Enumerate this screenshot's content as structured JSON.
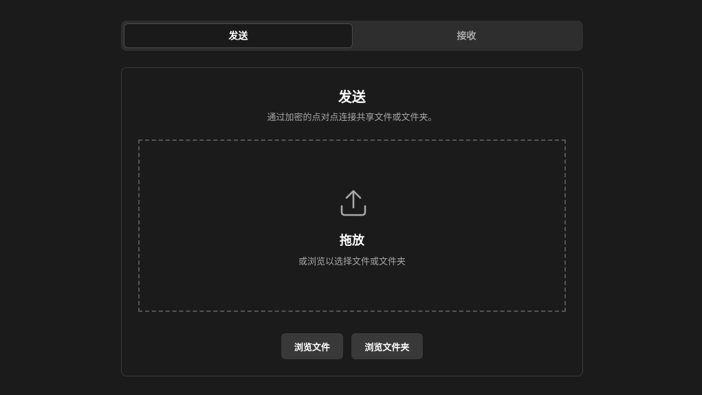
{
  "tabs": [
    {
      "label": "发送",
      "active": true
    },
    {
      "label": "接收",
      "active": false
    }
  ],
  "card": {
    "title": "发送",
    "description": "通过加密的点对点连接共享文件或文件夹。"
  },
  "dropzone": {
    "icon": "upload-icon",
    "title": "拖放",
    "subtitle": "或浏览以选择文件或文件夹"
  },
  "buttons": {
    "browse_files": "浏览文件",
    "browse_folder": "浏览文件夹"
  },
  "colors": {
    "background": "#1b1b1b",
    "tab_bar": "#2e2e2e",
    "button": "#393939",
    "muted_text": "#a6a6a6"
  }
}
